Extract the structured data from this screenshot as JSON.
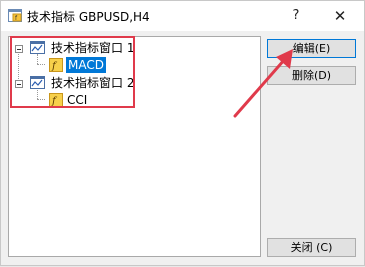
{
  "window": {
    "title": "技术指标 GBPUSD,H4",
    "help_label": "?",
    "close_label": "✕"
  },
  "tree": {
    "items": [
      {
        "label": "技术指标窗口 1",
        "children": [
          {
            "label": "MACD",
            "selected": true
          }
        ]
      },
      {
        "label": "技术指标窗口 2",
        "children": [
          {
            "label": "CCI",
            "selected": false
          }
        ]
      }
    ]
  },
  "buttons": {
    "edit_label": "编辑(E)",
    "delete_label": "删除(D)",
    "close_label": "关闭 (C)"
  },
  "colors": {
    "highlight": "#e03a4b",
    "selection": "#0078d7",
    "accent_button_border": "#0078d7"
  },
  "icons": {
    "app": "indicator-window-icon",
    "window": "chart-window-icon",
    "indicator": "indicator-f-icon"
  }
}
